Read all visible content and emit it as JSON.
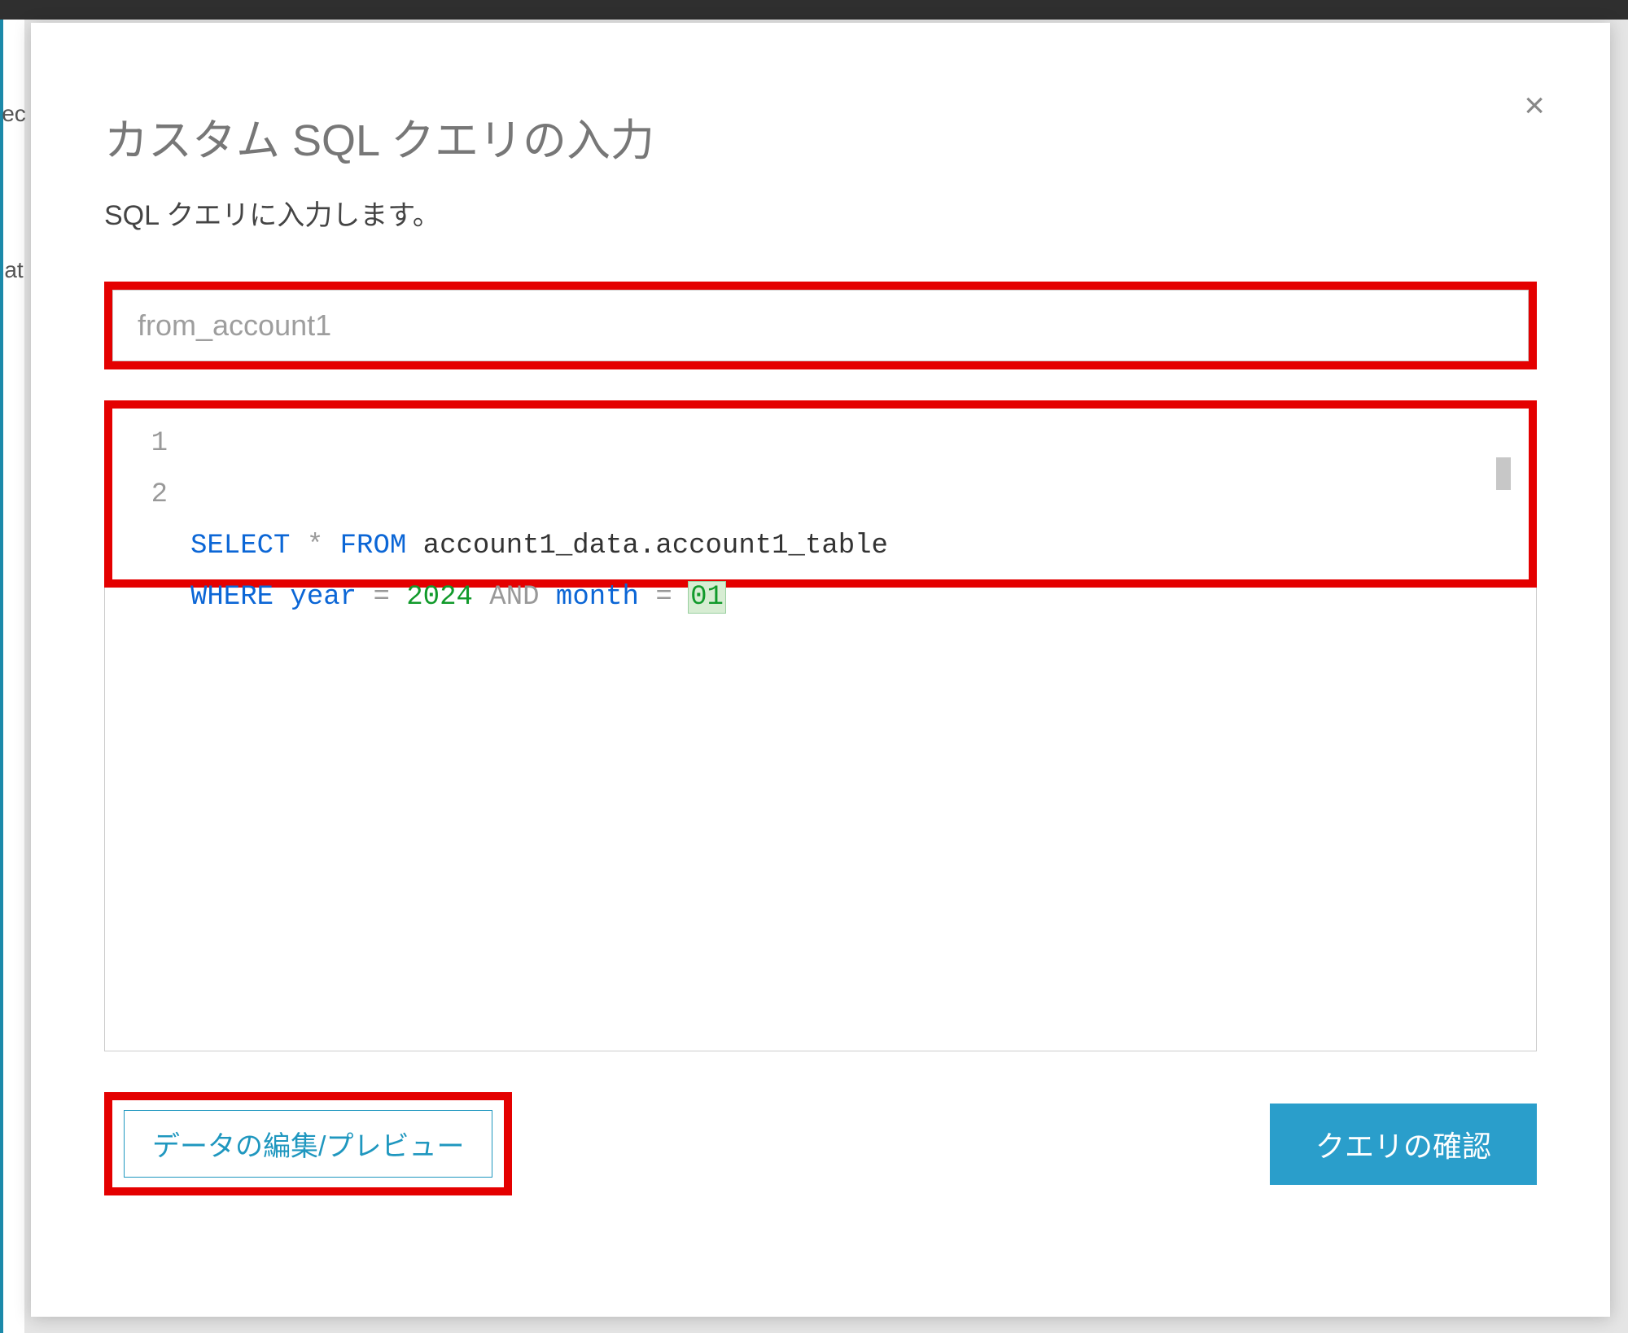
{
  "background": {
    "sidebar_fragments": [
      "ec",
      "at"
    ]
  },
  "modal": {
    "title": "カスタム SQL クエリの入力",
    "subtitle": "SQL クエリに入力します。",
    "close_label": "×",
    "name_input": {
      "value": "from_account1"
    },
    "sql": {
      "lines": [
        {
          "n": "1",
          "tokens": [
            {
              "cls": "kw",
              "t": "SELECT "
            },
            {
              "cls": "op",
              "t": "* "
            },
            {
              "cls": "kw",
              "t": "FROM "
            },
            {
              "cls": "txt",
              "t": "account1_data.account1_table"
            }
          ]
        },
        {
          "n": "2",
          "tokens": [
            {
              "cls": "kw",
              "t": "WHERE "
            },
            {
              "cls": "id",
              "t": "year "
            },
            {
              "cls": "op",
              "t": "= "
            },
            {
              "cls": "num",
              "t": "2024 "
            },
            {
              "cls": "op",
              "t": "AND "
            },
            {
              "cls": "id",
              "t": "month "
            },
            {
              "cls": "op",
              "t": "= "
            },
            {
              "cls": "num cursor-cell",
              "t": "01"
            }
          ]
        }
      ]
    },
    "footer": {
      "edit_preview_label": "データの編集/プレビュー",
      "confirm_label": "クエリの確認"
    }
  }
}
